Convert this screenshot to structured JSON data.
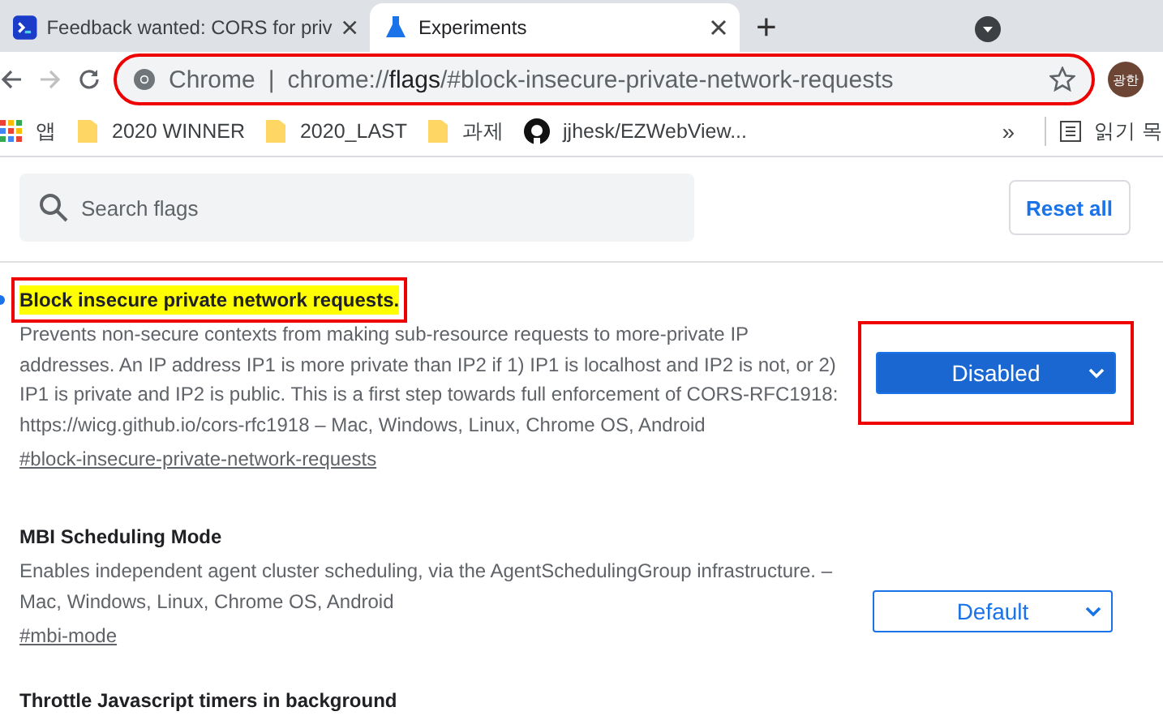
{
  "tabs": [
    {
      "title": "Feedback wanted: CORS for priv",
      "selected": false
    },
    {
      "title": "Experiments",
      "selected": true
    }
  ],
  "new_tab": "+",
  "address_bar": {
    "site": "Chrome",
    "separator": "|",
    "prefix": "chrome://",
    "host": "flags",
    "path": "/#block-insecure-private-network-requests",
    "annotated": true
  },
  "profile": {
    "initials": "광한"
  },
  "bookmarks": [
    {
      "label": "앱",
      "kind": "apps"
    },
    {
      "label": "2020 WINNER",
      "kind": "folder"
    },
    {
      "label": "2020_LAST",
      "kind": "folder"
    },
    {
      "label": "과제",
      "kind": "folder"
    },
    {
      "label": "jjhesk/EZWebView...",
      "kind": "github"
    }
  ],
  "bookmarks_overflow": "»",
  "reading_list": "읽기 목",
  "search": {
    "placeholder": "Search flags"
  },
  "reset_button": "Reset all",
  "flags": [
    {
      "title": "Block insecure private network requests.",
      "description": "Prevents non-secure contexts from making sub-resource requests to more-private IP addresses. An IP address IP1 is more private than IP2 if 1) IP1 is localhost and IP2 is not, or 2) IP1 is private and IP2 is public. This is a first step towards full enforcement of CORS-RFC1918: https://wicg.github.io/cors-rfc1918 – Mac, Windows, Linux, Chrome OS, Android",
      "link": "#block-insecure-private-network-requests",
      "value": "Disabled",
      "modified": true,
      "highlighted": true
    },
    {
      "title": "MBI Scheduling Mode",
      "description": "Enables independent agent cluster scheduling, via the AgentSchedulingGroup infrastructure. – Mac, Windows, Linux, Chrome OS, Android",
      "link": "#mbi-mode",
      "value": "Default",
      "modified": false,
      "highlighted": false
    },
    {
      "title": "Throttle Javascript timers in background"
    }
  ]
}
